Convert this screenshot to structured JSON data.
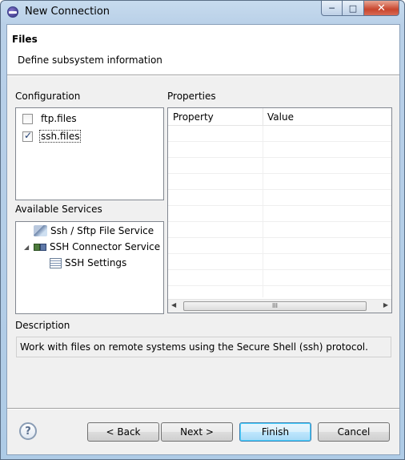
{
  "window": {
    "title": "New Connection",
    "buttons": {
      "minimize": "─",
      "maximize": "□",
      "close": "✕"
    }
  },
  "banner": {
    "title": "Files",
    "description": "Define subsystem information"
  },
  "configuration": {
    "label": "Configuration",
    "items": [
      {
        "label": "ftp.files",
        "checked": false
      },
      {
        "label": "ssh.files",
        "checked": true
      }
    ]
  },
  "available_services": {
    "label": "Available Services",
    "items": [
      {
        "label": "Ssh / Sftp File Service",
        "icon": "file-service-icon"
      },
      {
        "label": "SSH Connector Service",
        "icon": "connector-service-icon",
        "expanded": true
      },
      {
        "label": "SSH Settings",
        "icon": "settings-table-icon"
      }
    ]
  },
  "properties": {
    "label": "Properties",
    "columns": [
      "Property",
      "Value"
    ],
    "scroll_arrows": {
      "left": "◀",
      "right": "▶",
      "grip": "III"
    }
  },
  "description": {
    "label": "Description",
    "text": "Work with files on remote systems using the Secure Shell (ssh) protocol."
  },
  "footer": {
    "help": "?",
    "back": "< Back",
    "next": "Next >",
    "finish": "Finish",
    "cancel": "Cancel"
  }
}
